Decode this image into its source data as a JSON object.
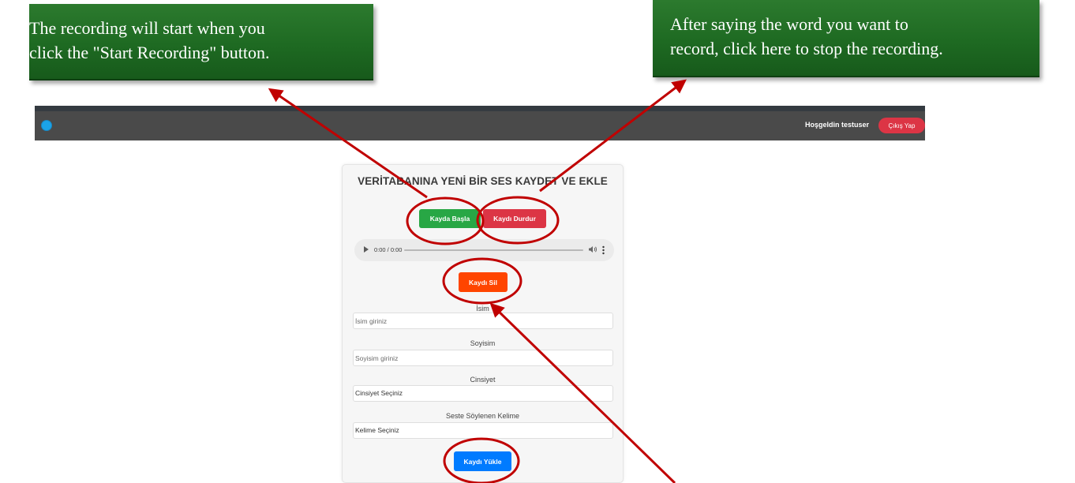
{
  "callouts": {
    "left": {
      "line1": "The recording will start when you",
      "line2": "click the \"Start Recording\" button."
    },
    "right": {
      "line1": "After saying the word you want to",
      "line2": "record, click here to stop the recording."
    }
  },
  "navbar": {
    "welcome": "Hoşgeldin testuser",
    "logout_label": "Çıkış Yap"
  },
  "form": {
    "title": "VERİTABANINA YENİ BİR SES KAYDET VE EKLE",
    "start_label": "Kayda Başla",
    "stop_label": "Kaydı Durdur",
    "audio_time": "0:00 / 0:00",
    "delete_label": "Kaydı Sil",
    "name_label": "İsim",
    "name_placeholder": "İsim giriniz",
    "surname_label": "Soyisim",
    "surname_placeholder": "Soyisim giriniz",
    "gender_label": "Cinsiyet",
    "gender_value": "Cinsiyet Seçiniz",
    "word_label": "Seste Söylenen Kelime",
    "word_value": "Kelime Seçiniz",
    "upload_label": "Kaydı Yükle"
  },
  "colors": {
    "annotation": "#c00000",
    "callout_bg": "#1e6a22",
    "start": "#28a745",
    "stop": "#dc3545",
    "delete": "#ff4500",
    "upload": "#007bff"
  }
}
